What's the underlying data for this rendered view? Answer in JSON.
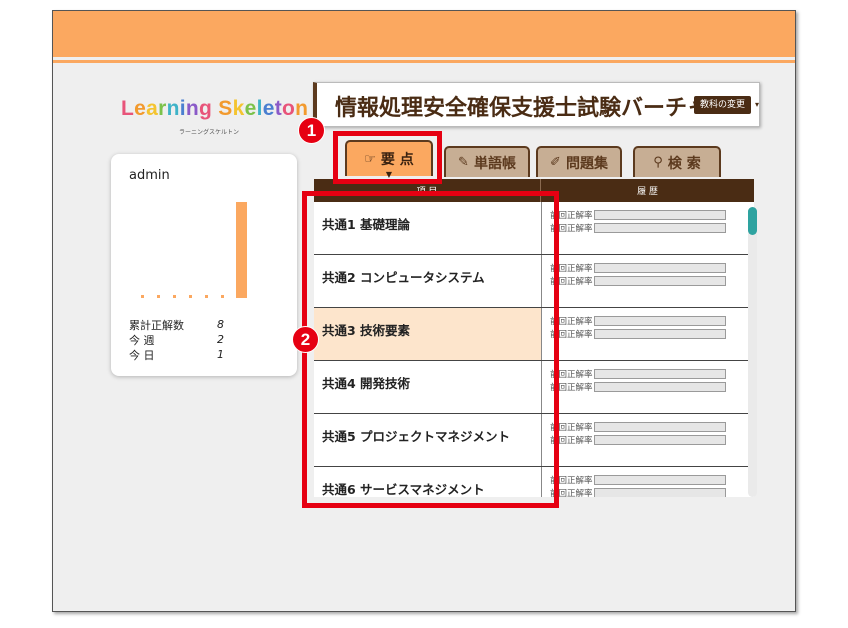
{
  "logo": {
    "text_parts": [
      {
        "t": "L",
        "c": "#e8547a"
      },
      {
        "t": "e",
        "c": "#f29a2e"
      },
      {
        "t": "a",
        "c": "#f4c430"
      },
      {
        "t": "r",
        "c": "#7cc24a"
      },
      {
        "t": "n",
        "c": "#3fb3c8"
      },
      {
        "t": "i",
        "c": "#4a7fd0"
      },
      {
        "t": "n",
        "c": "#8a5ac8"
      },
      {
        "t": "g",
        "c": "#e8547a"
      },
      {
        "t": " ",
        "c": "#000"
      },
      {
        "t": "S",
        "c": "#f29a2e"
      },
      {
        "t": "k",
        "c": "#f4c430"
      },
      {
        "t": "e",
        "c": "#7cc24a"
      },
      {
        "t": "l",
        "c": "#3fb3c8"
      },
      {
        "t": "e",
        "c": "#4a7fd0"
      },
      {
        "t": "t",
        "c": "#8a5ac8"
      },
      {
        "t": "o",
        "c": "#e8547a"
      },
      {
        "t": "n",
        "c": "#f29a2e"
      }
    ],
    "subtitle": "ラーニングスケルトン"
  },
  "user": {
    "name": "admin",
    "stats": [
      {
        "label": "累計正解数",
        "value": "8"
      },
      {
        "label": "今 週",
        "value": "2"
      },
      {
        "label": "今 日",
        "value": "1"
      }
    ]
  },
  "chart_data": {
    "type": "bar",
    "values": [
      0,
      0,
      0,
      0,
      0,
      0,
      1
    ],
    "ylim": [
      0,
      1
    ],
    "bar_color": "#fba860"
  },
  "course": {
    "title": "情報処理安全確保支援士試験バーチャル",
    "change_label": "教科の変更",
    "change_caret": "▾"
  },
  "tabs": [
    {
      "icon": "☞",
      "label": "要 点",
      "active": true
    },
    {
      "icon": "✎",
      "label": "単語帳",
      "active": false
    },
    {
      "icon": "✐",
      "label": "問題集",
      "active": false
    },
    {
      "icon": "⚲",
      "label": "検 索",
      "active": false
    }
  ],
  "table": {
    "col_item": "項 目",
    "col_history": "履 歴",
    "hist_label_1": "前回正解率",
    "hist_label_2": "前回正解率",
    "rows": [
      {
        "title": "共通1 基礎理論",
        "highlight": false
      },
      {
        "title": "共通2 コンピュータシステム",
        "highlight": false
      },
      {
        "title": "共通3 技術要素",
        "highlight": true
      },
      {
        "title": "共通4 開発技術",
        "highlight": false
      },
      {
        "title": "共通5 プロジェクトマネジメント",
        "highlight": false
      },
      {
        "title": "共通6 サービスマネジメント",
        "highlight": false
      }
    ]
  },
  "callouts": {
    "one": "1",
    "two": "2"
  },
  "colors": {
    "accent": "#fba860",
    "brown": "#4a2c14",
    "callout": "#e60012",
    "highlight": "#fde5cc"
  }
}
